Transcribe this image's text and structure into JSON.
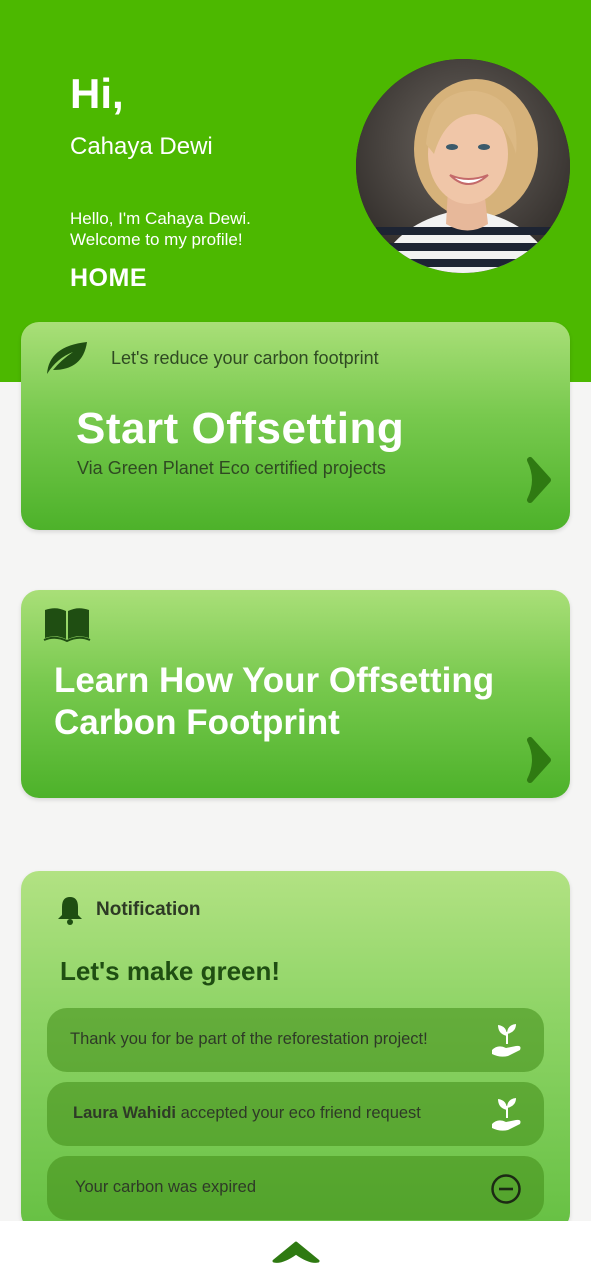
{
  "header": {
    "hi": "Hi,",
    "name": "Cahaya Dewi",
    "message_line1": "Hello, I'm Cahaya Dewi.",
    "message_line2": "Welcome to my profile!",
    "home": "HOME",
    "avatar_icon": "profile-photo"
  },
  "offset_card": {
    "icon": "leaf-icon",
    "subtitle": "Let's reduce your carbon footprint",
    "title": "Start Offsetting",
    "description": "Via Green Planet Eco certified projects"
  },
  "learn_card": {
    "icon": "book-icon",
    "title_line1": "Learn How Your Offsetting",
    "title_line2": "Carbon Footprint"
  },
  "notifications": {
    "icon": "bell-icon",
    "label": "Notification",
    "title": "Let's make green!",
    "items": [
      {
        "text": "Thank you for be part of the reforestation project!",
        "icon": "plant-hand-icon"
      },
      {
        "name": "Laura Wahidi",
        "text": " accepted your eco friend request",
        "icon": "plant-hand-icon"
      },
      {
        "text": "Your carbon was expired",
        "icon": "minus-circle-icon"
      }
    ]
  },
  "colors": {
    "header_green": "#4cb800",
    "dark_green": "#1f4e12",
    "background": "#f5f5f4"
  },
  "bottom_bar": {
    "icon": "chevron-up-icon"
  }
}
